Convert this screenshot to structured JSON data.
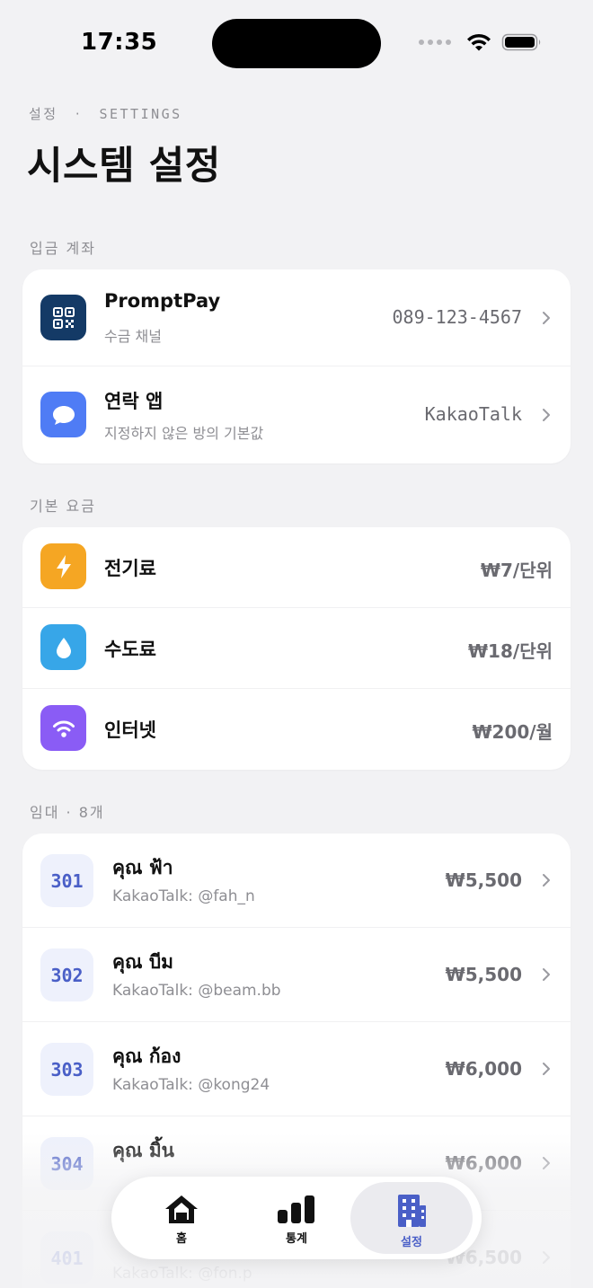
{
  "status_bar": {
    "time": "17:35"
  },
  "header": {
    "eyebrow_ko": "설정",
    "eyebrow_sep": "·",
    "eyebrow_en": "SETTINGS",
    "title": "시스템 설정"
  },
  "deposit": {
    "label": "입금 계좌",
    "items": [
      {
        "title": "PromptPay",
        "subtitle": "수금 채널",
        "value": "089-123-4567",
        "icon": "qr-code-icon"
      },
      {
        "title": "연락 앱",
        "subtitle": "지정하지 않은 방의 기본값",
        "value": "KakaoTalk",
        "icon": "chat-bubble-icon"
      }
    ]
  },
  "rates": {
    "label": "기본 요금",
    "items": [
      {
        "title": "전기료",
        "value": "₩7/단위",
        "icon": "lightning-icon"
      },
      {
        "title": "수도료",
        "value": "₩18/단위",
        "icon": "water-drop-icon"
      },
      {
        "title": "인터넷",
        "value": "₩200/월",
        "icon": "wifi-icon"
      }
    ]
  },
  "rentals": {
    "label": "임대 · 8개",
    "items": [
      {
        "unit": "301",
        "name": "คุณ ฟ้า",
        "contact": "KakaoTalk: @fah_n",
        "rent": "₩5,500"
      },
      {
        "unit": "302",
        "name": "คุณ บีม",
        "contact": "KakaoTalk: @beam.bb",
        "rent": "₩5,500"
      },
      {
        "unit": "303",
        "name": "คุณ ก้อง",
        "contact": "KakaoTalk: @kong24",
        "rent": "₩6,000"
      },
      {
        "unit": "304",
        "name": "คุณ มิ้น",
        "contact": "",
        "rent": "₩6,000"
      },
      {
        "unit": "401",
        "name": "",
        "contact": "KakaoTalk: @fon.p",
        "rent": "₩6,500"
      }
    ]
  },
  "tabbar": {
    "tabs": [
      {
        "label": "홈",
        "icon": "home-icon",
        "active": false
      },
      {
        "label": "통계",
        "icon": "bar-chart-icon",
        "active": false
      },
      {
        "label": "설정",
        "icon": "building-icon",
        "active": true
      }
    ]
  },
  "colors": {
    "accent": "#4a5fc7",
    "qr_bg": "#143a66",
    "chat_bg": "#4f7cf5",
    "electric_bg": "#f5a623",
    "water_bg": "#37a6e8",
    "internet_bg": "#8a5cf5"
  }
}
